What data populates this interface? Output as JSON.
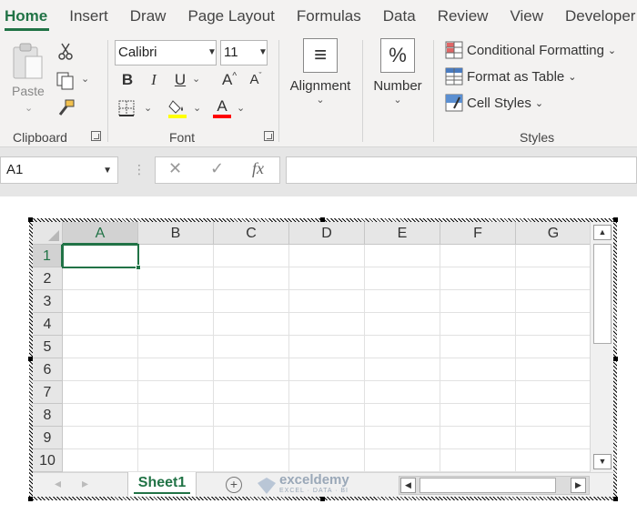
{
  "tabs": [
    "Home",
    "Insert",
    "Draw",
    "Page Layout",
    "Formulas",
    "Data",
    "Review",
    "View",
    "Developer"
  ],
  "clipboard": {
    "paste_label": "Paste",
    "group_label": "Clipboard"
  },
  "font": {
    "name": "Calibri",
    "size": "11",
    "bold": "B",
    "italic": "I",
    "underline": "U",
    "grow": "A",
    "shrink": "A",
    "font_color": "A",
    "group_label": "Font"
  },
  "alignment": {
    "label": "Alignment",
    "glyph": "≡"
  },
  "number": {
    "label": "Number",
    "glyph": "%"
  },
  "styles": {
    "conditional": "Conditional Formatting",
    "table": "Format as Table",
    "cell_styles": "Cell Styles",
    "group_label": "Styles"
  },
  "formula_bar": {
    "name_box": "A1",
    "fx": "fx",
    "cancel": "✕",
    "enter": "✓",
    "value": ""
  },
  "sheet": {
    "columns": [
      "A",
      "B",
      "C",
      "D",
      "E",
      "F",
      "G"
    ],
    "rows": [
      "1",
      "2",
      "3",
      "4",
      "5",
      "6",
      "7",
      "8",
      "9",
      "10"
    ],
    "selected_cell": "A1",
    "tab": "Sheet1",
    "add_sheet": "+",
    "watermark": "exceldemy",
    "watermark_tagline": "EXCEL · DATA · BI"
  },
  "colors": {
    "accent": "#217346",
    "highlight": "#ffff00",
    "font_color": "#ff0000"
  }
}
